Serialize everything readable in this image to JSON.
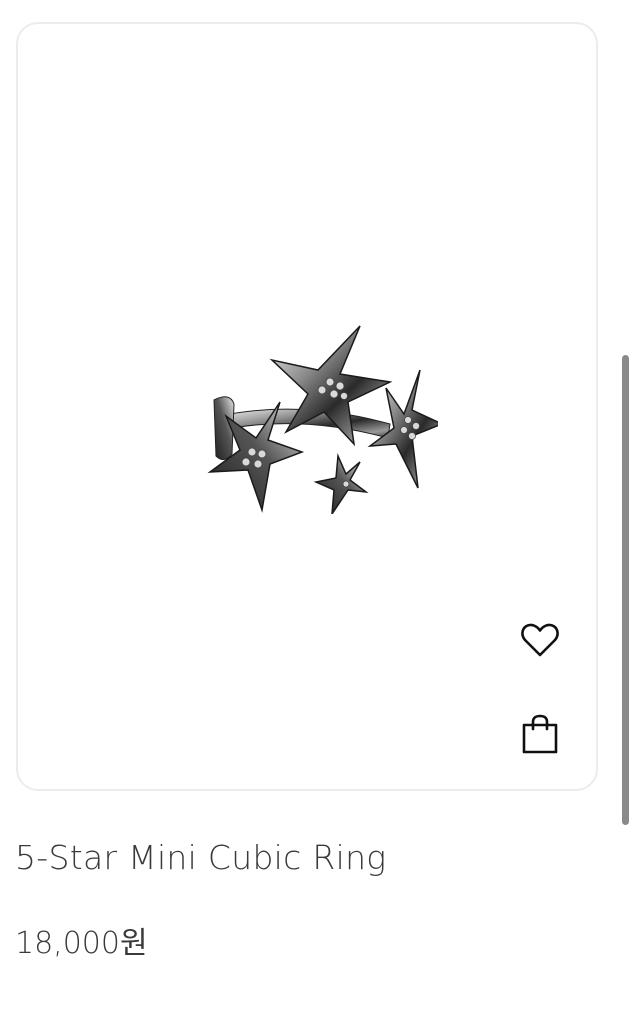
{
  "product": {
    "name": "5-Star Mini Cubic Ring",
    "price": "18,000원",
    "image_subject": "silver star ring with cubic stones"
  },
  "actions": {
    "wishlist_icon": "heart-icon",
    "cart_icon": "shopping-bag-icon"
  },
  "colors": {
    "card_border": "#ececec",
    "text": "#3a3a3a",
    "icon": "#111111",
    "scrollbar": "#8a8a8a"
  }
}
